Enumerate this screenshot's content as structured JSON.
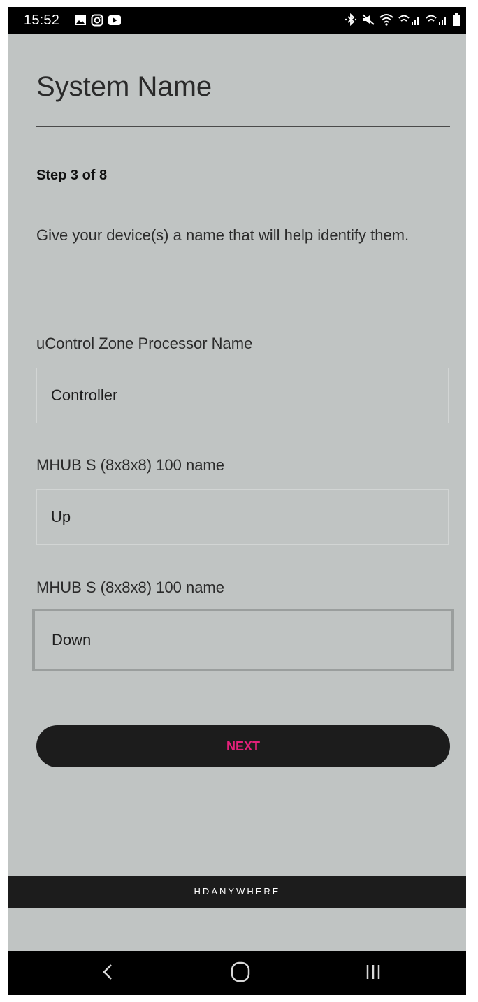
{
  "status_bar": {
    "time": "15:52",
    "icons_left": [
      "gallery-icon",
      "instagram-icon",
      "youtube-icon"
    ],
    "icons_right": [
      "bluetooth-icon",
      "mute-icon",
      "wifi-icon",
      "wifi-calling-icon-1",
      "wifi-calling-icon-2",
      "battery-icon"
    ]
  },
  "page": {
    "title": "System Name",
    "step": "Step 3 of 8",
    "description": "Give your device(s) a name that will help identify them."
  },
  "fields": [
    {
      "label": "uControl Zone Processor Name",
      "value": "Controller"
    },
    {
      "label": "MHUB S (8x8x8) 100 name",
      "value": "Up"
    },
    {
      "label": "MHUB S (8x8x8) 100 name",
      "value": "Down"
    }
  ],
  "actions": {
    "next_label": "NEXT"
  },
  "footer": {
    "brand": "HDANYWHERE"
  },
  "nav": {
    "buttons": [
      "back-icon",
      "home-icon",
      "recent-apps-icon"
    ]
  },
  "colors": {
    "background": "#c0c4c3",
    "accent": "#e4207a",
    "button": "#1c1c1c"
  }
}
